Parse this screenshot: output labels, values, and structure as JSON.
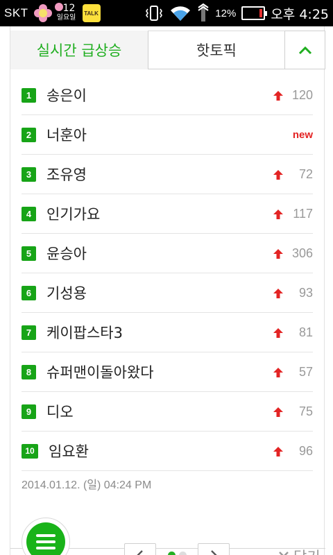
{
  "status_bar": {
    "carrier": "SKT",
    "date_num": "12",
    "date_day": "일요일",
    "talk_label": "TALK",
    "battery_pct": "12%",
    "battery_level": 0.12,
    "time": "오후 4:25"
  },
  "tabs": {
    "active_label": "실시간 급상승",
    "other_label": "핫토픽"
  },
  "keywords": [
    {
      "rank": "1",
      "text": "송은이",
      "change": "120",
      "is_new": false
    },
    {
      "rank": "2",
      "text": "너훈아",
      "change": "new",
      "is_new": true
    },
    {
      "rank": "3",
      "text": "조유영",
      "change": "72",
      "is_new": false
    },
    {
      "rank": "4",
      "text": "인기가요",
      "change": "117",
      "is_new": false
    },
    {
      "rank": "5",
      "text": "윤승아",
      "change": "306",
      "is_new": false
    },
    {
      "rank": "6",
      "text": "기성용",
      "change": "93",
      "is_new": false
    },
    {
      "rank": "7",
      "text": "케이팝스타3",
      "change": "81",
      "is_new": false
    },
    {
      "rank": "8",
      "text": "슈퍼맨이돌아왔다",
      "change": "57",
      "is_new": false
    },
    {
      "rank": "9",
      "text": "디오",
      "change": "75",
      "is_new": false
    },
    {
      "rank": "10",
      "text": "임요환",
      "change": "96",
      "is_new": false
    }
  ],
  "timestamp": "2014.01.12. (일) 04:24 PM",
  "pager": {
    "page": 1,
    "total_pages": 2
  },
  "close_label": "닫기",
  "colors": {
    "accent_green": "#1fae1f",
    "up_red": "#e32424"
  },
  "icons": {
    "collapse": "chevron-up-icon",
    "menu": "hamburger-menu-icon",
    "prev": "chevron-left-icon",
    "next": "chevron-right-icon",
    "close": "close-x-icon",
    "rise": "arrow-up-icon"
  }
}
